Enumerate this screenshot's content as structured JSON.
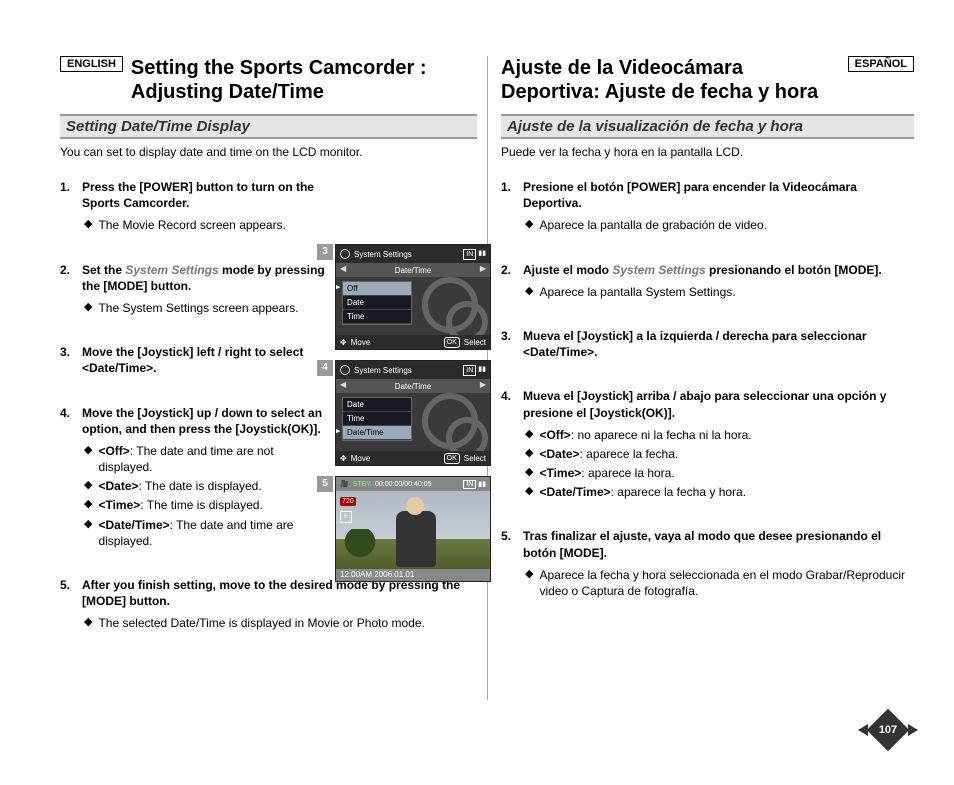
{
  "left": {
    "lang": "ENGLISH",
    "title": "Setting the Sports Camcorder : Adjusting Date/Time",
    "section": "Setting Date/Time Display",
    "intro": "You can set to display date and time on the LCD monitor.",
    "sys_settings_label": "System Settings",
    "steps": [
      {
        "n": "1.",
        "head": "Press the [POWER] button to turn on the Sports Camcorder.",
        "subs": [
          {
            "text": "The Movie Record screen appears."
          }
        ]
      },
      {
        "n": "2.",
        "head_pre": "Set the ",
        "head_post": " mode by pressing the [MODE] button.",
        "subs": [
          {
            "text": "The System Settings screen appears."
          }
        ]
      },
      {
        "n": "3.",
        "head": "Move the [Joystick] left / right to select <Date/Time>."
      },
      {
        "n": "4.",
        "head": "Move the [Joystick] up / down to select an option, and then press the [Joystick(OK)].",
        "subs": [
          {
            "b": "<Off>",
            "text": ": The date and time are not displayed."
          },
          {
            "b": "<Date>",
            "text": ": The date is displayed."
          },
          {
            "b": "<Time>",
            "text": ": The time is displayed."
          },
          {
            "b": "<Date/Time>",
            "text": ": The date and time are displayed."
          }
        ]
      },
      {
        "n": "5.",
        "head": "After you finish setting, move to the desired mode by pressing the [MODE] button.",
        "subs": [
          {
            "text": "The selected Date/Time is displayed in Movie or Photo mode."
          }
        ]
      }
    ]
  },
  "right": {
    "lang": "ESPAÑOL",
    "title": "Ajuste de la Videocámara Deportiva: Ajuste de fecha y hora",
    "section": "Ajuste de la visualización de fecha y hora",
    "intro": "Puede ver la fecha y hora en la pantalla LCD.",
    "sys_settings_label": "System Settings",
    "steps": [
      {
        "n": "1.",
        "head": "Presione el botón [POWER] para encender la Videocámara Deportiva.",
        "subs": [
          {
            "text": "Aparece la pantalla de grabación de video."
          }
        ]
      },
      {
        "n": "2.",
        "head_pre": "Ajuste el modo ",
        "head_post": " presionando el botón [MODE].",
        "subs": [
          {
            "text": "Aparece la pantalla System Settings."
          }
        ]
      },
      {
        "n": "3.",
        "head": "Mueva el [Joystick] a la izquierda / derecha para seleccionar <Date/Time>."
      },
      {
        "n": "4.",
        "head": "Mueva el [Joystick] arriba / abajo para seleccionar una opción y presione el [Joystick(OK)].",
        "subs": [
          {
            "b": "<Off>",
            "text": ": no aparece ni la fecha ni la hora."
          },
          {
            "b": "<Date>",
            "text": ": aparece la fecha."
          },
          {
            "b": "<Time>",
            "text": ": aparece la hora."
          },
          {
            "b": "<Date/Time>",
            "text": ": aparece la fecha y hora."
          }
        ]
      },
      {
        "n": "5.",
        "head": "Tras finalizar el ajuste, vaya al modo que desee presionando el botón [MODE].",
        "subs": [
          {
            "text": "Aparece la fecha y hora seleccionada en el modo Grabar/Reproducir video o Captura de fotografía."
          }
        ]
      }
    ]
  },
  "shots": {
    "s3": {
      "tag": "3",
      "title": "System Settings",
      "tab": "Date/Time",
      "menu": [
        "Off",
        "Date",
        "Time"
      ],
      "sel_index": 0,
      "move": "Move",
      "select": "Select",
      "in": "IN"
    },
    "s4": {
      "tag": "4",
      "title": "System Settings",
      "tab": "Date/Time",
      "menu": [
        "Date",
        "Time",
        "Date/Time"
      ],
      "sel_index": 2,
      "move": "Move",
      "select": "Select",
      "in": "IN"
    },
    "s5": {
      "tag": "5",
      "stby": "STBY",
      "counter": "00:00:00/00:40:05",
      "in": "IN",
      "res": "720",
      "fine": "F",
      "timestamp": "12:00AM 2006.01.01"
    }
  },
  "page_number": "107"
}
